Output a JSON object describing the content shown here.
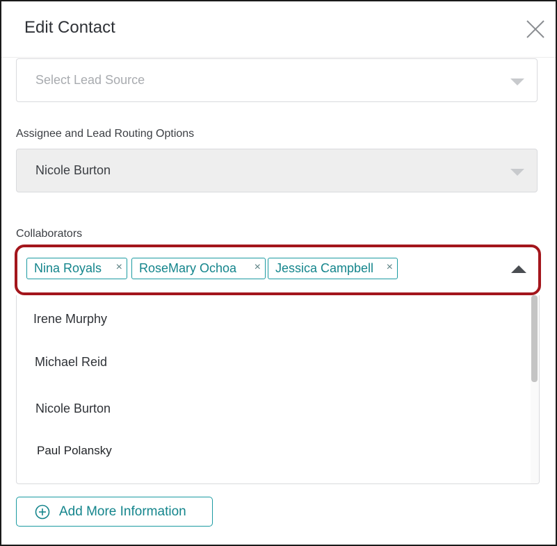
{
  "dialog": {
    "title": "Edit Contact"
  },
  "lead_source": {
    "placeholder": "Select Lead Source"
  },
  "assignee": {
    "label": "Assignee and Lead Routing Options",
    "value": "Nicole Burton"
  },
  "collaborators": {
    "label": "Collaborators",
    "selected": [
      "Nina Royals",
      "RoseMary Ochoa",
      "Jessica Campbell"
    ],
    "remove_glyph": "×",
    "options": [
      "Irene Murphy",
      "Michael Reid",
      "Nicole Burton",
      "Paul Polansky"
    ]
  },
  "footer": {
    "add_more_label": "Add More Information"
  },
  "colors": {
    "accent": "#1a9aa1",
    "highlight_border": "#a3161c",
    "disabled_bg": "#eeeeee"
  }
}
